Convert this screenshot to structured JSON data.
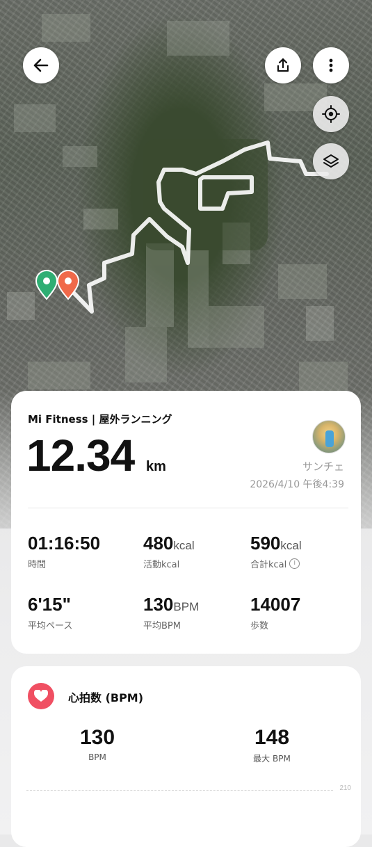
{
  "header": {
    "back_icon": "arrow-left-icon",
    "share_icon": "share-icon",
    "more_icon": "more-vertical-icon",
    "locate_icon": "locate-icon",
    "layers_icon": "layers-icon"
  },
  "map": {
    "start_marker_color": "#2fae73",
    "end_marker_color": "#f0694a",
    "route_color": "#ffffff"
  },
  "summary": {
    "app_title": "Mi Fitness | 屋外ランニング",
    "distance": "12.34",
    "distance_unit": "km",
    "user_name": "サンチェ",
    "datetime": "2026/4/10 午後4:39",
    "stats": [
      {
        "value": "01:16:50",
        "unit": "",
        "label": "時間"
      },
      {
        "value": "480",
        "unit": "kcal",
        "label": "活動kcal"
      },
      {
        "value": "590",
        "unit": "kcal",
        "label": "合計kcal"
      },
      {
        "value": "6'15\"",
        "unit": "",
        "label": "平均ペース"
      },
      {
        "value": "130",
        "unit": "BPM",
        "label": "平均BPM"
      },
      {
        "value": "14007",
        "unit": "",
        "label": "歩数"
      }
    ]
  },
  "heart_rate": {
    "title": "心拍数 (BPM)",
    "avg_value": "130",
    "avg_label": "BPM",
    "max_value": "148",
    "max_label": "最大 BPM",
    "axis_top": "210",
    "accent": "#f04f62"
  }
}
